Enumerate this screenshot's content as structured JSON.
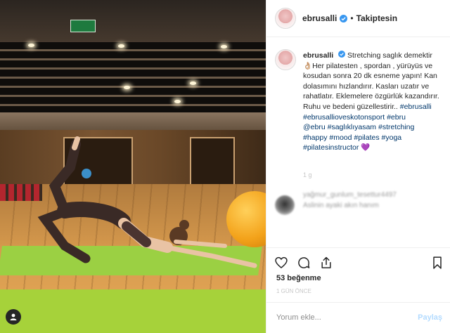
{
  "header": {
    "username": "ebrusalli",
    "separator": "•",
    "follow_status": "Takiptesin"
  },
  "caption": {
    "username": "ebrusalli",
    "text_line1": "Stretching saglık demektir",
    "text_body": "Her pilatesten , spordan , yürüyüs ve kosudan sonra 20 dk esneme yapın! Kan dolasımını hızlandırır. Kasları uzatır ve rahatlatır. Eklemelere özgürlük kazandırır. Ruhu ve bedeni güzellestirir.. ",
    "emoji_hand": "👌🏼",
    "hashtags": [
      "#ebrusalli",
      "#ebrusallioveskotonsport",
      "#ebru",
      "@ebru",
      "#saglıklıyasam",
      "#stretching",
      "#happy",
      "#mood",
      "#pilates",
      "#yoga",
      "#pilatesinstructor"
    ],
    "emoji_heart": "💜",
    "time": "1 g"
  },
  "comment": {
    "user": "yağmur_gunlum_tesettur4497",
    "text": "Aslinin ayaki akın hanım"
  },
  "actions": {
    "like_icon": "heart-icon",
    "comment_icon": "comment-icon",
    "share_icon": "share-icon",
    "save_icon": "bookmark-icon"
  },
  "likes": "53 beğenme",
  "post_time": "1 GÜN ÖNCE",
  "add_comment": {
    "placeholder": "Yorum ekle...",
    "post_label": "Paylaş"
  },
  "colors": {
    "verified": "#3897f0",
    "hashtag": "#00376b",
    "mat": "#a6d23a",
    "ball": "#f3a21a"
  }
}
